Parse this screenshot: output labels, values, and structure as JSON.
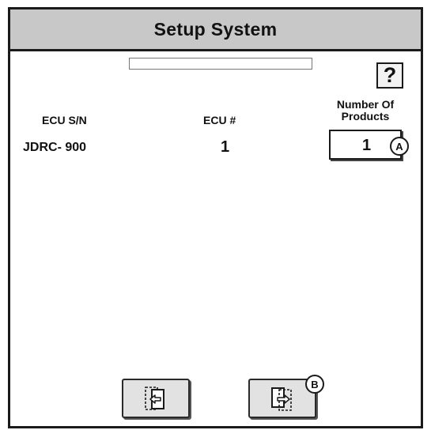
{
  "header": {
    "title": "Setup System"
  },
  "help": {
    "label": "?"
  },
  "columns": {
    "ecu_sn_label": "ECU S/N",
    "ecu_num_label": "ECU #",
    "num_products_label_line1": "Number Of",
    "num_products_label_line2": "Products"
  },
  "row": {
    "ecu_sn": "JDRC- 900",
    "ecu_num": "1",
    "num_products": "1"
  },
  "callouts": {
    "a": "A",
    "b": "B"
  },
  "navigation": {
    "back_icon": "exit-left-icon",
    "next_icon": "enter-right-icon"
  },
  "colors": {
    "title_bar": "#c8c8c8",
    "border": "#1a1a1a",
    "button_face": "#e2e2e2"
  }
}
